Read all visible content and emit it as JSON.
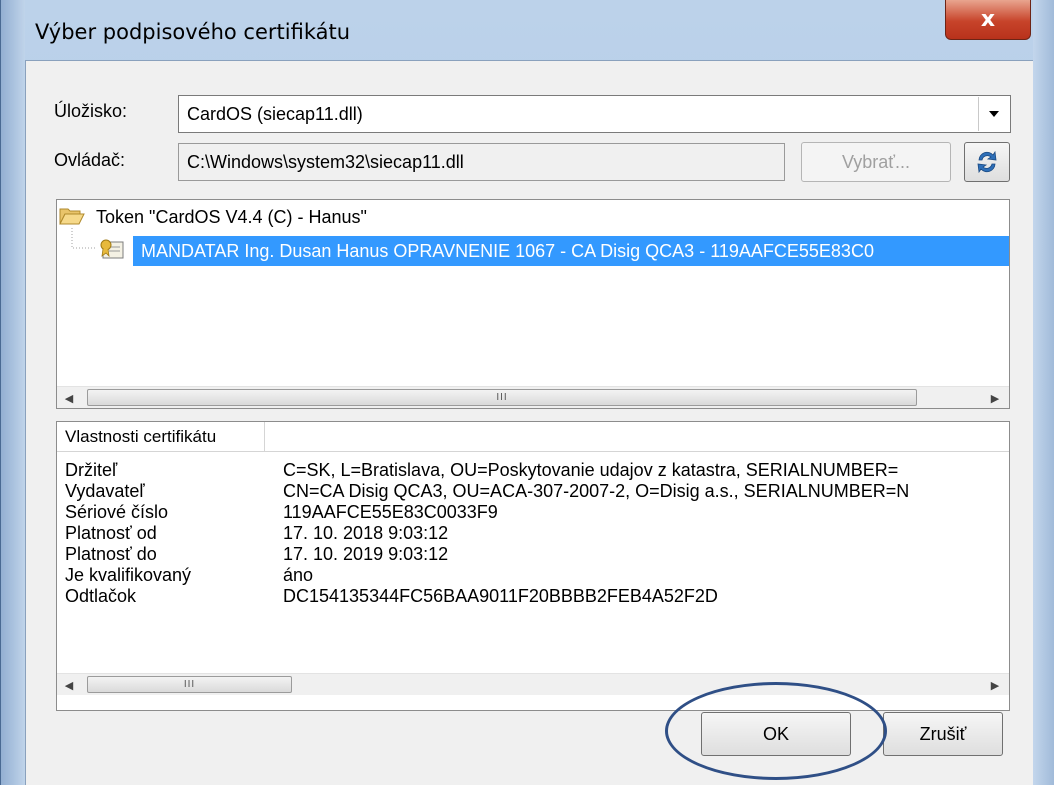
{
  "window": {
    "title": "Výber podpisového certifikátu",
    "close_label": "x",
    "accent_color": "#3399ff"
  },
  "storage": {
    "label": "Úložisko:",
    "selected_value": "CardOS (siecap11.dll)"
  },
  "driver": {
    "label": "Ovládač:",
    "value": "C:\\Windows\\system32\\siecap11.dll",
    "select_button": "Vybrať..."
  },
  "tree": {
    "token_label": "Token \"CardOS V4.4 (C) - Hanus\"",
    "certificate_label": "MANDATAR Ing. Dusan Hanus OPRAVNENIE 1067 - CA Disig QCA3 - 119AAFCE55E83C0",
    "scroll_grip": "III"
  },
  "properties": {
    "column_header": "Vlastnosti certifikátu",
    "rows": [
      {
        "name": "Držiteľ",
        "value": "C=SK, L=Bratislava, OU=Poskytovanie udajov z katastra, SERIALNUMBER="
      },
      {
        "name": "Vydavateľ",
        "value": "CN=CA Disig QCA3, OU=ACA-307-2007-2, O=Disig a.s., SERIALNUMBER=N"
      },
      {
        "name": "Sériové číslo",
        "value": "119AAFCE55E83C0033F9"
      },
      {
        "name": "Platnosť od",
        "value": "17. 10. 2018 9:03:12"
      },
      {
        "name": "Platnosť do",
        "value": "17. 10. 2019 9:03:12"
      },
      {
        "name": "Je kvalifikovaný",
        "value": "áno"
      },
      {
        "name": "Odtlačok",
        "value": "DC154135344FC56BAA9011F20BBBB2FEB4A52F2D"
      }
    ],
    "scroll_grip": "III"
  },
  "buttons": {
    "ok": "OK",
    "cancel": "Zrušiť"
  }
}
